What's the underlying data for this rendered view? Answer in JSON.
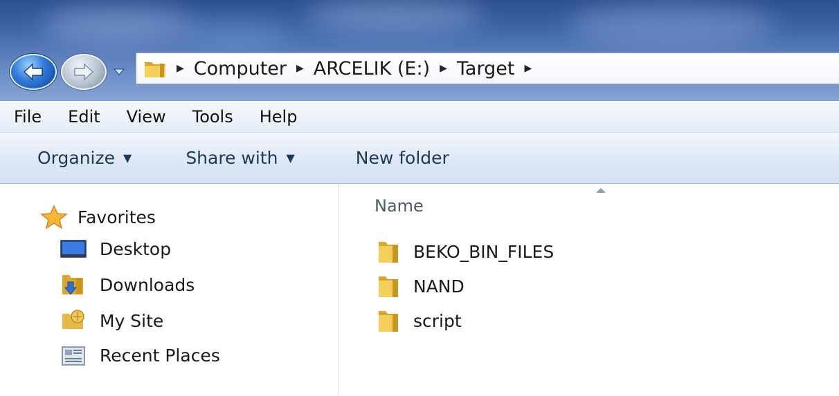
{
  "address_bar": {
    "breadcrumbs": [
      "Computer",
      "ARCELIK (E:)",
      "Target"
    ]
  },
  "menu": {
    "items": [
      "File",
      "Edit",
      "View",
      "Tools",
      "Help"
    ]
  },
  "toolbar": {
    "organize_label": "Organize",
    "share_label": "Share with",
    "new_folder_label": "New folder"
  },
  "nav_pane": {
    "favorites_label": "Favorites",
    "items": [
      {
        "label": "Desktop",
        "icon": "desktop-icon"
      },
      {
        "label": "Downloads",
        "icon": "downloads-folder-icon"
      },
      {
        "label": "My Site",
        "icon": "site-icon"
      },
      {
        "label": "Recent Places",
        "icon": "recent-places-icon"
      }
    ]
  },
  "content": {
    "column_header": "Name",
    "sort": "ascending",
    "files": [
      {
        "name": "BEKO_BIN_FILES",
        "type": "folder"
      },
      {
        "name": "NAND",
        "type": "folder"
      },
      {
        "name": "script",
        "type": "folder"
      }
    ]
  },
  "colors": {
    "title_bar": "#3d63a5",
    "command_text": "#1e395b",
    "folder": "#e8b93a"
  }
}
